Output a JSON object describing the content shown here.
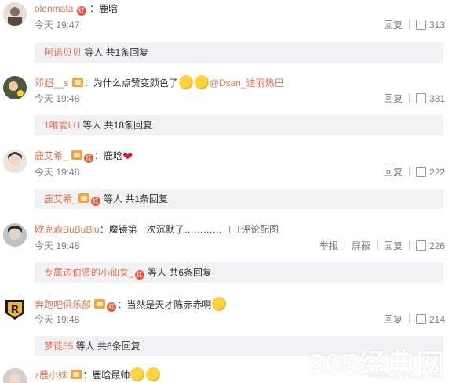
{
  "comments": [
    {
      "username": "olenmata",
      "badges": [
        "红"
      ],
      "text": "：鹿晗",
      "time": "今天 19:47",
      "reply_label": "回复",
      "likes": "313",
      "reply_summary": {
        "who": "阿诺贝贝",
        "rest": " 等人 共1条回复"
      }
    },
    {
      "username": "邓超__s",
      "text": "：为什么点赞变颜色了",
      "mention": "@Dsan_迪丽热巴",
      "time": "今天 19:48",
      "reply_label": "回复",
      "likes": "331",
      "reply_summary": {
        "who": "1唯爱LH",
        "rest": " 等人 共18条回复"
      }
    },
    {
      "username": "鹿艾希_",
      "badges": [
        "红"
      ],
      "text": "：鹿晗",
      "time": "今天 19:48",
      "reply_label": "回复",
      "likes": "222",
      "reply_summary": {
        "who": "鹿艾希_",
        "badge": "红",
        "rest": " 等人 共1条回复"
      }
    },
    {
      "username": "欧克森BuBuBiu",
      "text": "：魔镜第一次沉默了…………",
      "image_link": "评论配图",
      "time": "今天 19:48",
      "report_label": "举报",
      "block_label": "屏蔽",
      "reply_label": "回复",
      "likes": "226",
      "reply_summary": {
        "who": "专属边伯贤的小仙女_",
        "badge": "红",
        "rest": " 等人 共6条回复"
      }
    },
    {
      "username": "奔跑吧俱乐部",
      "badges": [
        "红"
      ],
      "text": "：当然是天才陈赤赤啊",
      "time": "今天 19:48",
      "reply_label": "回复",
      "likes": "214",
      "reply_summary": {
        "who": "梦徒55",
        "rest": " 等人 共6条回复"
      }
    },
    {
      "username": "z鹿小妹",
      "text": "：鹿晗最帅"
    }
  ],
  "watermark": {
    "main": "365经典网",
    "sub": "www.365j.com"
  },
  "colors": {
    "username": "#eb7350",
    "reply_bg": "#f2f2f5",
    "badge": "#e25a3a"
  }
}
